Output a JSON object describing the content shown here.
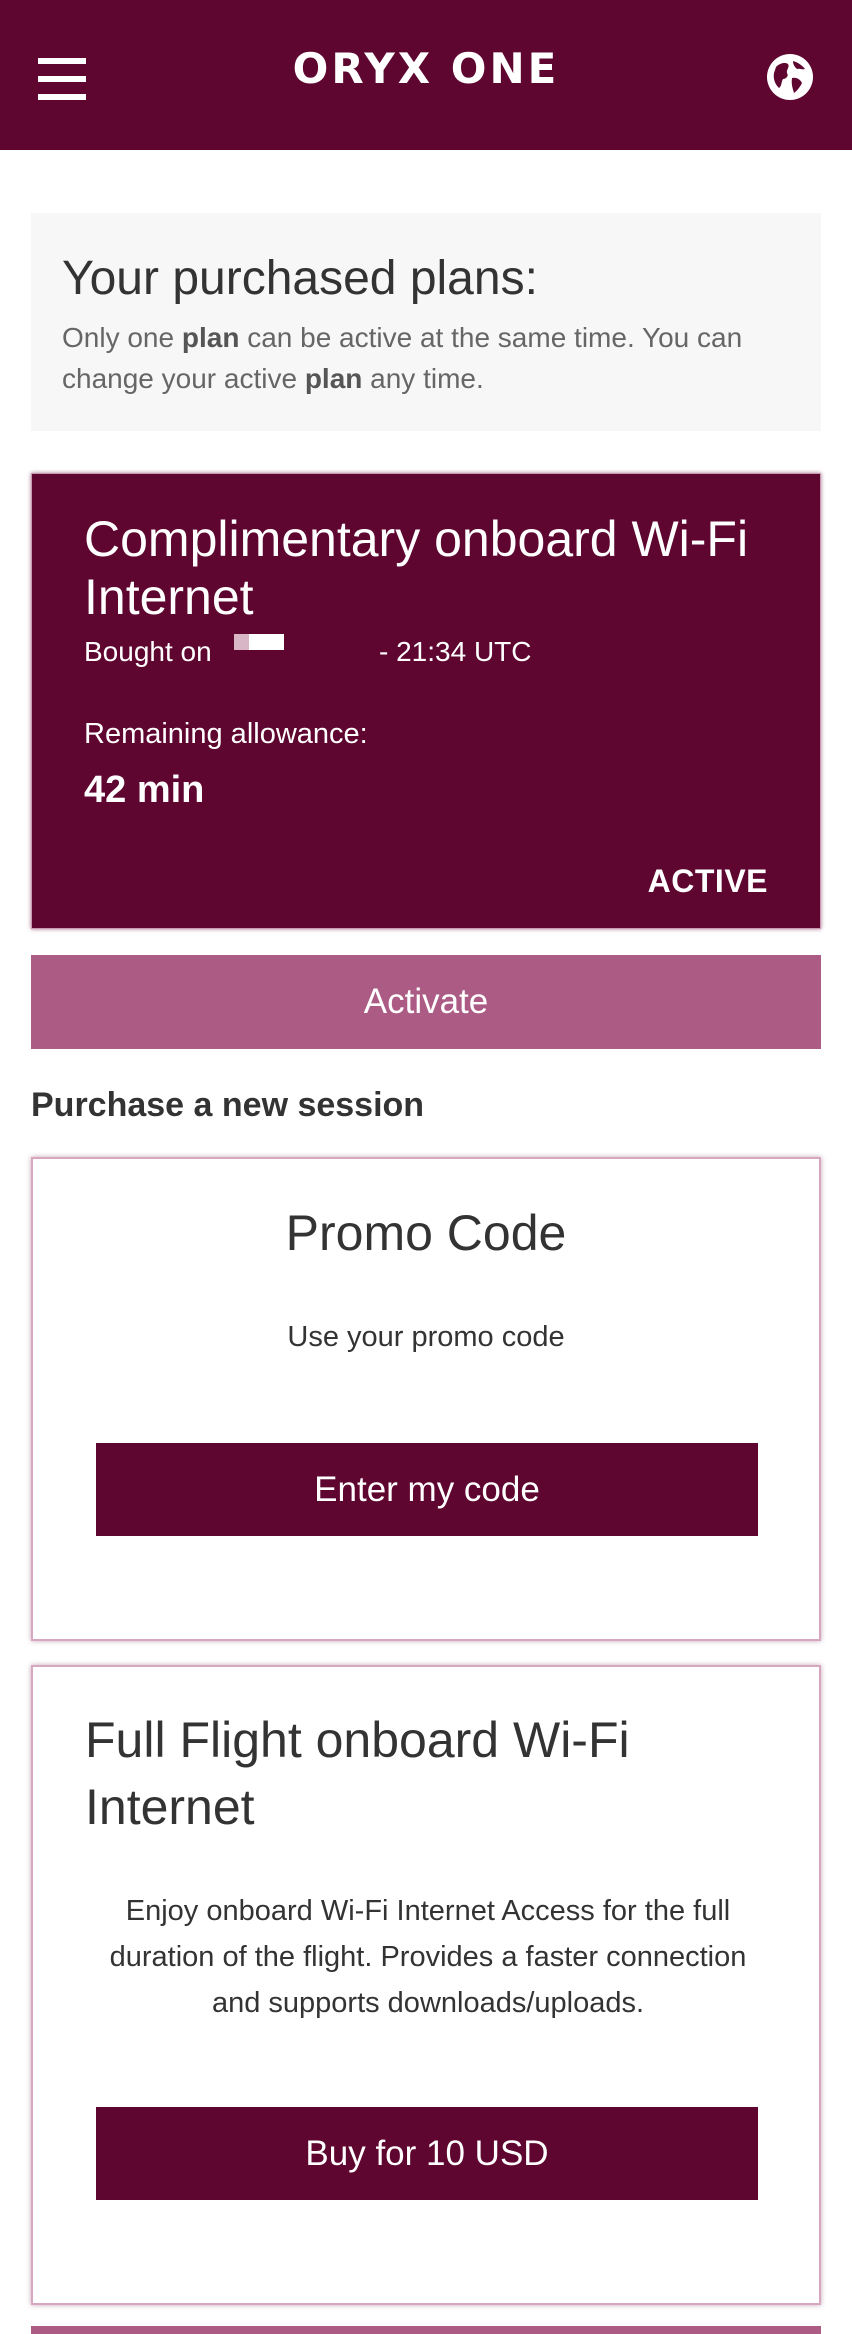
{
  "header": {
    "logo_text": "ORYX ONE",
    "menu_icon": "hamburger-menu-icon",
    "language_icon": "globe-icon",
    "background_color": "#5e0530"
  },
  "intro": {
    "title": "Your purchased plans:",
    "text_1": "Only one ",
    "bold_1": "plan",
    "text_2": " can be active at the same time. You can change your active ",
    "bold_2": "plan",
    "text_3": " any time."
  },
  "active_plan": {
    "name": "Complimentary onboard Wi-Fi Internet",
    "bought_label": "Bought on",
    "bought_time": "- 21:34 UTC",
    "remaining_label": "Remaining allowance:",
    "remaining_value": "42 min",
    "status": "ACTIVE"
  },
  "activate_button": {
    "label": "Activate",
    "color": "#ac5c84"
  },
  "purchase_section": {
    "title": "Purchase a new session"
  },
  "promo_card": {
    "title": "Promo Code",
    "description": "Use your promo code",
    "button_label": "Enter my code"
  },
  "full_flight_card": {
    "title": "Full Flight onboard Wi-Fi Internet",
    "description": "Enjoy onboard Wi-Fi Internet Access for the full duration of the flight. Provides a faster connection and supports downloads/uploads.",
    "button_label": "Buy for 10 USD"
  },
  "colors": {
    "brand": "#5e0530",
    "accent": "#ac5c84",
    "card_border": "#d7a7c0"
  }
}
